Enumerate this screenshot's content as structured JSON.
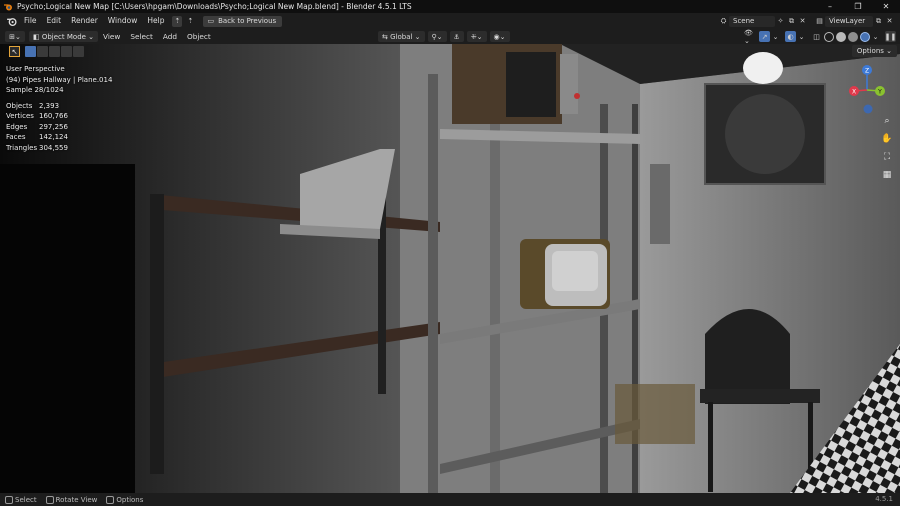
{
  "window": {
    "title": "Psycho;Logical New Map [C:\\Users\\hpgam\\Downloads\\Psycho;Logical New Map.blend] - Blender 4.5.1 LTS",
    "controls": [
      "–",
      "❐",
      "✕"
    ]
  },
  "topbar": {
    "menus": [
      "File",
      "Edit",
      "Render",
      "Window",
      "Help"
    ],
    "back_button": "Back to Previous",
    "scene": "Scene",
    "view_layer": "ViewLayer"
  },
  "viewport_header": {
    "mode": "Object Mode",
    "menus": [
      "View",
      "Select",
      "Add",
      "Object"
    ],
    "transform_orientation": "Global"
  },
  "tool_row": {
    "options_label": "Options"
  },
  "overlay": {
    "view_name": "User Perspective",
    "object_line": "(94) Pipes Hallway | Plane.014",
    "sample": "Sample 28/1024",
    "stats": [
      {
        "key": "Objects",
        "value": "2,393"
      },
      {
        "key": "Vertices",
        "value": "160,766"
      },
      {
        "key": "Edges",
        "value": "297,256"
      },
      {
        "key": "Faces",
        "value": "142,124"
      },
      {
        "key": "Triangles",
        "value": "304,559"
      }
    ]
  },
  "gizmo": {
    "axes": {
      "x": "X",
      "y": "Y",
      "z": "Z"
    },
    "colors": {
      "x": "#e0394b",
      "y": "#8ac22f",
      "z": "#3d7ad8",
      "neg": "#3d68b0"
    }
  },
  "nav_tools": [
    "zoom-icon",
    "hand-icon",
    "camera-icon",
    "grid-icon"
  ],
  "statusbar": {
    "items": [
      "Select",
      "Rotate View",
      "Options"
    ],
    "version": "4.5.1"
  },
  "colors": {
    "accent": "#4772b3",
    "active_tool": "#e3a53b"
  }
}
